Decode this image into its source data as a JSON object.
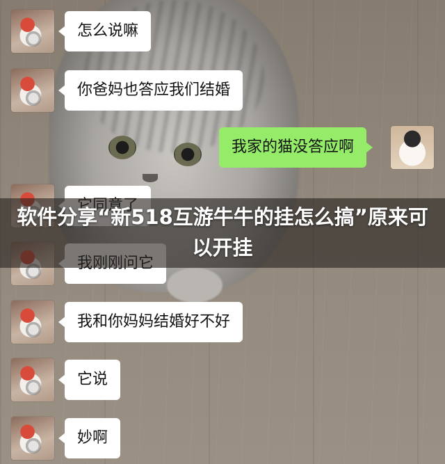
{
  "chat": {
    "messages": [
      {
        "text": "怎么说嘛",
        "side": "left"
      },
      {
        "text": "你爸妈也答应我们结婚",
        "side": "left"
      },
      {
        "text": "我家的猫没答应啊",
        "side": "right"
      },
      {
        "text": "它同意了",
        "side": "left"
      },
      {
        "text": "我刚刚问它",
        "side": "left"
      },
      {
        "text": "我和你妈妈结婚好不好",
        "side": "left"
      },
      {
        "text": "它说",
        "side": "left"
      },
      {
        "text": "妙啊",
        "side": "left"
      }
    ]
  },
  "overlay": {
    "title": "软件分享“新518互游牛牛的挂怎么搞”原来可以开挂"
  },
  "colors": {
    "bubble_self": "#95ec69",
    "bubble_other": "#ffffff",
    "banner": "#28241f"
  }
}
